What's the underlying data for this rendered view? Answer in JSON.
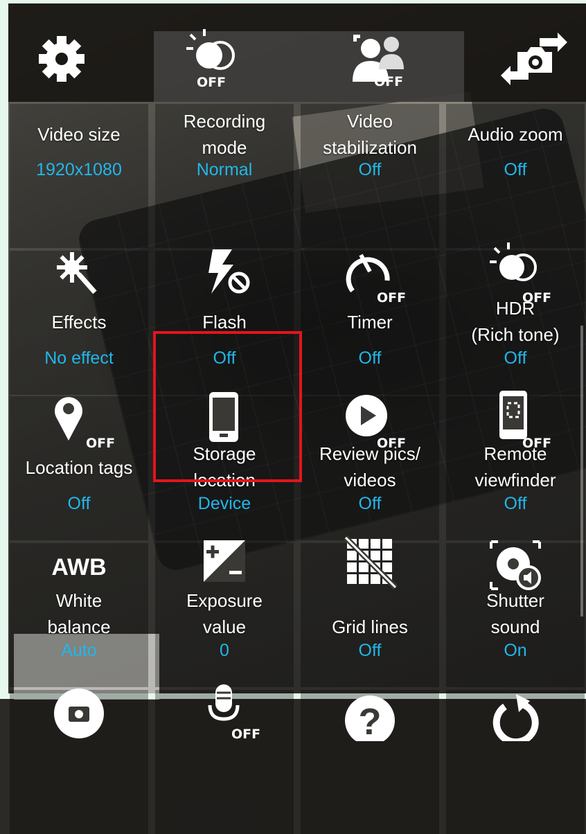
{
  "topbar": {
    "hdr_off": "OFF",
    "face_off": "OFF"
  },
  "settings": [
    {
      "label_lines": [
        "Video size"
      ],
      "value": "1920x1080",
      "icon": "none"
    },
    {
      "label_lines": [
        "Recording",
        "mode"
      ],
      "value": "Normal",
      "icon": "none"
    },
    {
      "label_lines": [
        "Video",
        "stabilization"
      ],
      "value": "Off",
      "icon": "none"
    },
    {
      "label_lines": [
        "Audio zoom"
      ],
      "value": "Off",
      "icon": "none"
    },
    {
      "label_lines": [
        "Effects"
      ],
      "value": "No effect",
      "icon": "effects-wand-icon"
    },
    {
      "label_lines": [
        "Flash"
      ],
      "value": "Off",
      "icon": "flash-off-icon"
    },
    {
      "label_lines": [
        "Timer"
      ],
      "value": "Off",
      "icon": "timer-off-icon",
      "icon_tag": "OFF"
    },
    {
      "label_lines": [
        "HDR",
        "(Rich tone)"
      ],
      "value": "Off",
      "icon": "hdr-off-icon",
      "icon_tag": "OFF"
    },
    {
      "label_lines": [
        "Location tags"
      ],
      "value": "Off",
      "icon": "location-off-icon",
      "icon_tag": "OFF"
    },
    {
      "label_lines": [
        "Storage",
        "location"
      ],
      "value": "Device",
      "icon": "phone-storage-icon"
    },
    {
      "label_lines": [
        "Review pics/",
        "videos"
      ],
      "value": "Off",
      "icon": "review-play-icon",
      "icon_tag": "OFF"
    },
    {
      "label_lines": [
        "Remote",
        "viewfinder"
      ],
      "value": "Off",
      "icon": "remote-viewfinder-icon",
      "icon_tag": "OFF"
    },
    {
      "label_lines": [
        "White",
        "balance"
      ],
      "value": "Auto",
      "icon": "awb-icon",
      "icon_text": "AWB"
    },
    {
      "label_lines": [
        "Exposure",
        "value"
      ],
      "value": "0",
      "icon": "exposure-icon"
    },
    {
      "label_lines": [
        "Grid lines"
      ],
      "value": "Off",
      "icon": "grid-off-icon"
    },
    {
      "label_lines": [
        "Shutter",
        "sound"
      ],
      "value": "On",
      "icon": "shutter-sound-icon"
    },
    {
      "label_lines": [],
      "value": "",
      "icon": "camera-icon"
    },
    {
      "label_lines": [],
      "value": "",
      "icon": "voice-control-off-icon",
      "icon_tag": "OFF"
    },
    {
      "label_lines": [],
      "value": "",
      "icon": "help-icon"
    },
    {
      "label_lines": [],
      "value": "",
      "icon": "reset-icon"
    }
  ],
  "colors": {
    "value_blue": "#21b7ea",
    "highlight_red": "#e5141b"
  }
}
